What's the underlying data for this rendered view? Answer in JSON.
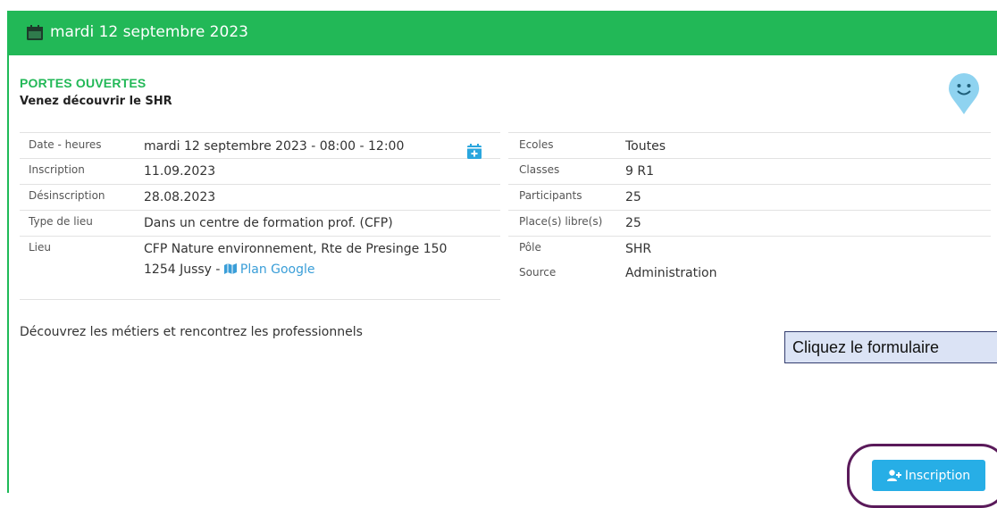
{
  "header": {
    "date_title": "mardi 12 septembre 2023"
  },
  "event": {
    "category": "PORTES OUVERTES",
    "subtitle": "Venez découvrir le SHR",
    "description": "Découvrez les métiers et rencontrez les professionnels"
  },
  "left_table": {
    "rows": [
      {
        "label": "Date - heures",
        "value": "mardi 12 septembre 2023 - 08:00 - 12:00"
      },
      {
        "label": "Inscription",
        "value": "11.09.2023"
      },
      {
        "label": "Désinscription",
        "value": "28.08.2023"
      },
      {
        "label": "Type de lieu",
        "value": "Dans un centre de formation prof. (CFP)"
      },
      {
        "label": "Lieu",
        "value": "CFP Nature environnement, Rte de Presinge 150",
        "value2": "1254 Jussy - ",
        "link": "Plan Google"
      }
    ]
  },
  "right_table": {
    "rows": [
      {
        "label": "Ecoles",
        "value": "Toutes"
      },
      {
        "label": "Classes",
        "value": "9 R1"
      },
      {
        "label": "Participants",
        "value": "25"
      },
      {
        "label": "Place(s) libre(s)",
        "value": "25"
      },
      {
        "label": "Pôle",
        "value": "SHR"
      },
      {
        "label": "Source",
        "value": "Administration"
      }
    ]
  },
  "callout": {
    "text": "Cliquez le formulaire"
  },
  "actions": {
    "inscription_label": "Inscription"
  },
  "colors": {
    "header_green": "#22b857",
    "button_blue": "#27aee6",
    "link_blue": "#3a9ed8",
    "ring_purple": "#5a1a5a"
  },
  "icons": [
    "calendar-icon",
    "calendar-plus-icon",
    "smiley-marker-icon",
    "map-icon",
    "user-plus-icon"
  ]
}
